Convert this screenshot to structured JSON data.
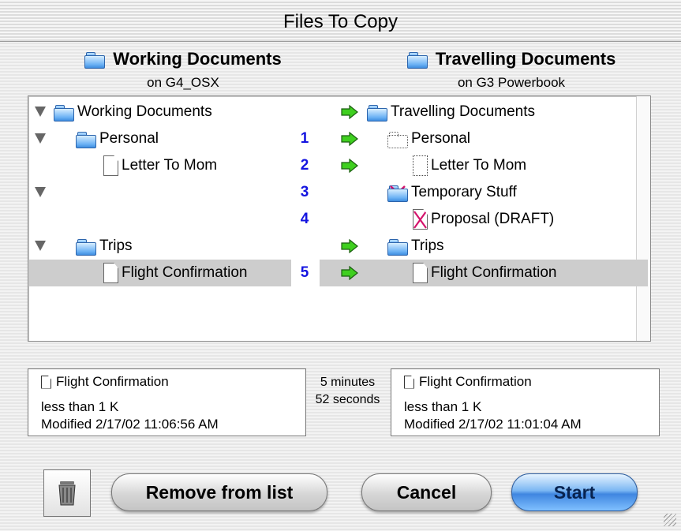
{
  "window": {
    "title": "Files To Copy"
  },
  "source": {
    "name": "Working Documents",
    "location": "on G4_OSX"
  },
  "destination": {
    "name": "Travelling Documents",
    "location": "on G3 Powerbook"
  },
  "rows": [
    {
      "left": "Working Documents",
      "num": "",
      "right": "Travelling Documents"
    },
    {
      "left": "Personal",
      "num": "1",
      "right": "Personal"
    },
    {
      "left": "Letter To Mom",
      "num": "2",
      "right": "Letter To Mom"
    },
    {
      "left": "",
      "num": "3",
      "right": "Temporary Stuff"
    },
    {
      "left": "",
      "num": "4",
      "right": "Proposal (DRAFT)"
    },
    {
      "left": "Trips",
      "num": "",
      "right": "Trips"
    },
    {
      "left": "Flight Confirmation",
      "num": "5",
      "right": "Flight Confirmation"
    }
  ],
  "info_left": {
    "name": "Flight Confirmation",
    "size": "less than 1 K",
    "modified": "Modified 2/17/02  11:06:56 AM"
  },
  "info_right": {
    "name": "Flight Confirmation",
    "size": "less than 1 K",
    "modified": "Modified 2/17/02  11:01:04 AM"
  },
  "elapsed": {
    "line1": "5 minutes",
    "line2": "52 seconds"
  },
  "buttons": {
    "remove": "Remove from list",
    "cancel": "Cancel",
    "start": "Start"
  },
  "colors": {
    "number": "#1414e0",
    "arrow": "#3fcf1f",
    "delete_mark": "#d4146c",
    "primary_button": "#3f86e0"
  }
}
